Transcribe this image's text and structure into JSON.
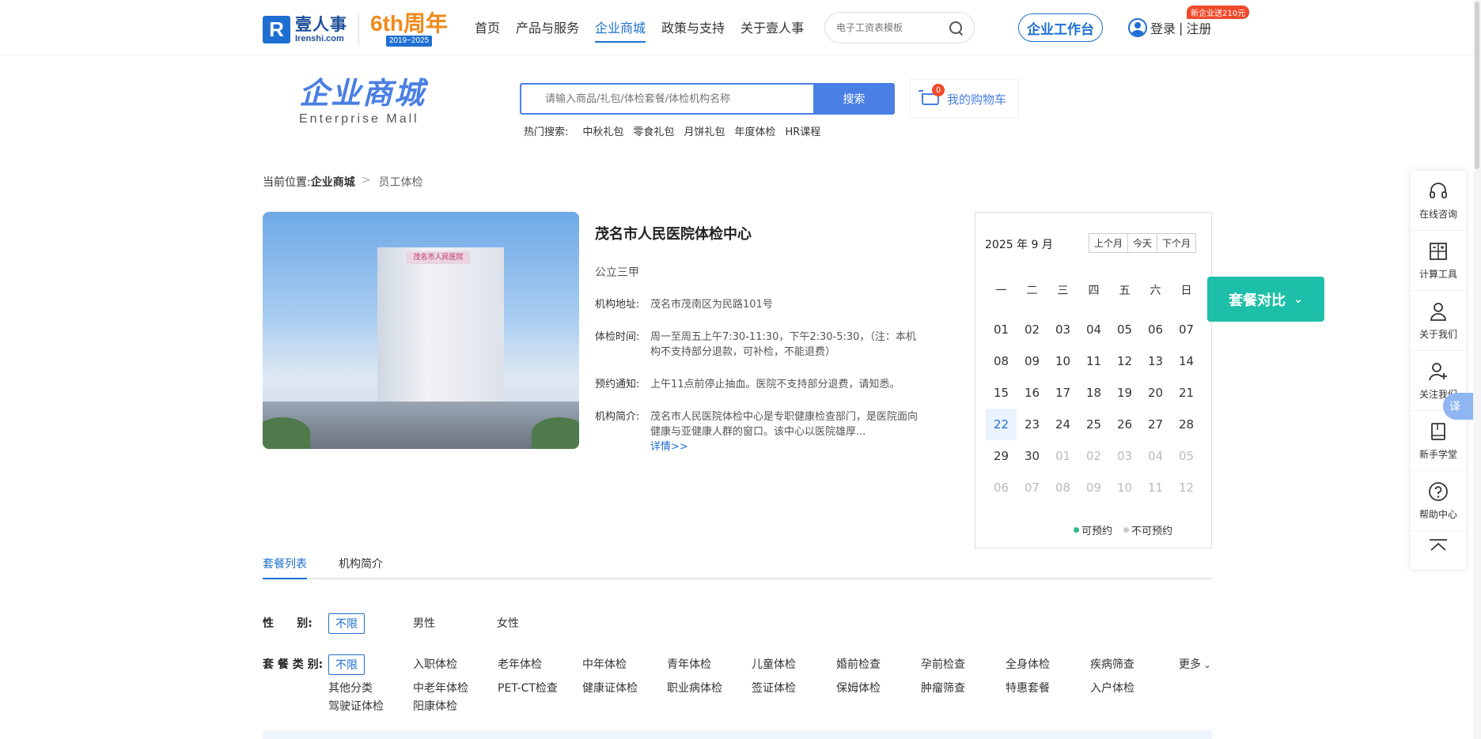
{
  "header": {
    "logo_cn": "壹人事",
    "logo_en": "Irenshi.com",
    "logo_mark": "R",
    "anniv_main": "6th周年",
    "anniv_sub": "2019~2025",
    "nav": [
      "首页",
      "产品与服务",
      "企业商城",
      "政策与支持",
      "关于壹人事"
    ],
    "nav_active_index": 2,
    "search_placeholder": "电子工资表模板",
    "workbench": "企业工作台",
    "login": "登录",
    "divider": "|",
    "register": "注册",
    "new_badge": "新企业送210元"
  },
  "mall": {
    "title_cn": "企业商城",
    "title_en": "Enterprise  Mall",
    "search_placeholder": "请输入商品/礼包/体检套餐/体检机构名称",
    "search_button": "搜索",
    "hot_label": "热门搜索:",
    "hot_items": [
      "中秋礼包",
      "零食礼包",
      "月饼礼包",
      "年度体检",
      "HR课程"
    ],
    "cart_count": "0",
    "cart_label": "我的购物车"
  },
  "breadcrumb": {
    "prefix": "当前位置:",
    "current": "企业商城",
    "sep": ">",
    "last": "员工体检"
  },
  "hospital": {
    "sign": "茂名市人民医院",
    "name": "茂名市人民医院体检中心",
    "level": "公立三甲",
    "address_label": "机构地址:",
    "address": "茂名市茂南区为民路101号",
    "time_label": "体检时间:",
    "time": "周一至周五上午7:30-11:30，下午2:30-5:30，（注：本机构不支持部分退款，可补检，不能退费）",
    "notice_label": "预约通知:",
    "notice": "上午11点前停止抽血。医院不支持部分退费，请知悉。",
    "intro_label": "机构简介:",
    "intro": "茂名市人民医院体检中心是专职健康检查部门，是医院面向健康与亚健康人群的窗口。该中心以医院雄厚...",
    "more": "详情>>"
  },
  "calendar": {
    "title": "2025 年 9 月",
    "buttons": [
      "上个月",
      "今天",
      "下个月"
    ],
    "weekdays": [
      "一",
      "二",
      "三",
      "四",
      "五",
      "六",
      "日"
    ],
    "days": [
      "01",
      "02",
      "03",
      "04",
      "05",
      "06",
      "07",
      "08",
      "09",
      "10",
      "11",
      "12",
      "13",
      "14",
      "15",
      "16",
      "17",
      "18",
      "19",
      "20",
      "21",
      "22",
      "23",
      "24",
      "25",
      "26",
      "27",
      "28",
      "29",
      "30",
      "01",
      "02",
      "03",
      "04",
      "05",
      "06",
      "07",
      "08",
      "09",
      "10",
      "11",
      "12"
    ],
    "today": "22",
    "legend_available": "可预约",
    "legend_unavailable": "不可预约"
  },
  "compare_button": "套餐对比",
  "tabs": [
    "套餐列表",
    "机构简介"
  ],
  "filters": {
    "gender_label": "性      别:",
    "gender_options": [
      "不限",
      "男性",
      "女性"
    ],
    "type_label": "套 餐 类 别:",
    "type_row1": [
      "不限",
      "入职体检",
      "老年体检",
      "中年体检",
      "青年体检",
      "儿童体检",
      "婚前检查",
      "孕前检查",
      "全身体检",
      "疾病筛查"
    ],
    "type_row2": [
      "其他分类",
      "中老年体检",
      "PET-CT检查",
      "健康证体检",
      "职业病体检",
      "签证体检",
      "保姆体检",
      "肿瘤筛查",
      "特惠套餐",
      "入户体检"
    ],
    "type_row3": [
      "驾驶证体检",
      "阳康体检"
    ],
    "more": "更多"
  },
  "sidebar": {
    "items": [
      "在线咨询",
      "计算工具",
      "关于我们",
      "关注我们",
      "新手学堂",
      "帮助中心"
    ],
    "translate": "译"
  },
  "colors": {
    "brand_blue": "#1d6fd1",
    "mall_blue": "#4a7fe3",
    "compare_teal": "#1ebfa8",
    "badge_red": "#f04a2a",
    "available_green": "#2cb88a"
  }
}
